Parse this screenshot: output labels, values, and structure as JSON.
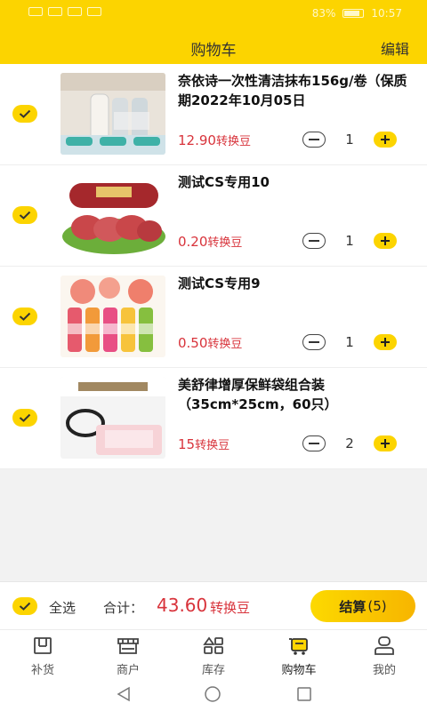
{
  "status_bar": {
    "left_icons": [
      "sim-icon",
      "signal-icon",
      "wifi-icon",
      "notification-icon"
    ],
    "battery": "83%",
    "time": "10:57"
  },
  "header": {
    "title": "购物车",
    "edit_label": "编辑"
  },
  "colors": {
    "brand": "#fcd400",
    "price": "#d8333b"
  },
  "cart": {
    "items": [
      {
        "name": "奈依诗一次性清洁抹布156g/卷（保质期2022年10月05日",
        "price": "12.90",
        "unit": "转换豆",
        "qty": "1",
        "image": "cleaning-cloth-image",
        "selected": true
      },
      {
        "name": "测试CS专用10",
        "price": "0.20",
        "unit": "转换豆",
        "qty": "1",
        "image": "sausage-image",
        "selected": true
      },
      {
        "name": "测试CS专用9",
        "price": "0.50",
        "unit": "转换豆",
        "qty": "1",
        "image": "juice-bottles-image",
        "selected": true
      },
      {
        "name": "美舒律增厚保鲜袋组合装（35cm*25cm，60只）",
        "price": "15",
        "unit": "转换豆",
        "qty": "2",
        "image": "freshness-bags-image",
        "selected": true
      }
    ]
  },
  "footer": {
    "select_all": "全选",
    "total_label": "合计：",
    "total": "43.60",
    "total_unit": "转换豆",
    "checkout_label": "结算",
    "checkout_count": "(5)"
  },
  "tabs": [
    {
      "label": "补货",
      "icon": "restock-icon",
      "active": false
    },
    {
      "label": "商户",
      "icon": "merchant-icon",
      "active": false
    },
    {
      "label": "库存",
      "icon": "inventory-icon",
      "active": false
    },
    {
      "label": "购物车",
      "icon": "cart-icon",
      "active": true
    },
    {
      "label": "我的",
      "icon": "profile-icon",
      "active": false
    }
  ]
}
